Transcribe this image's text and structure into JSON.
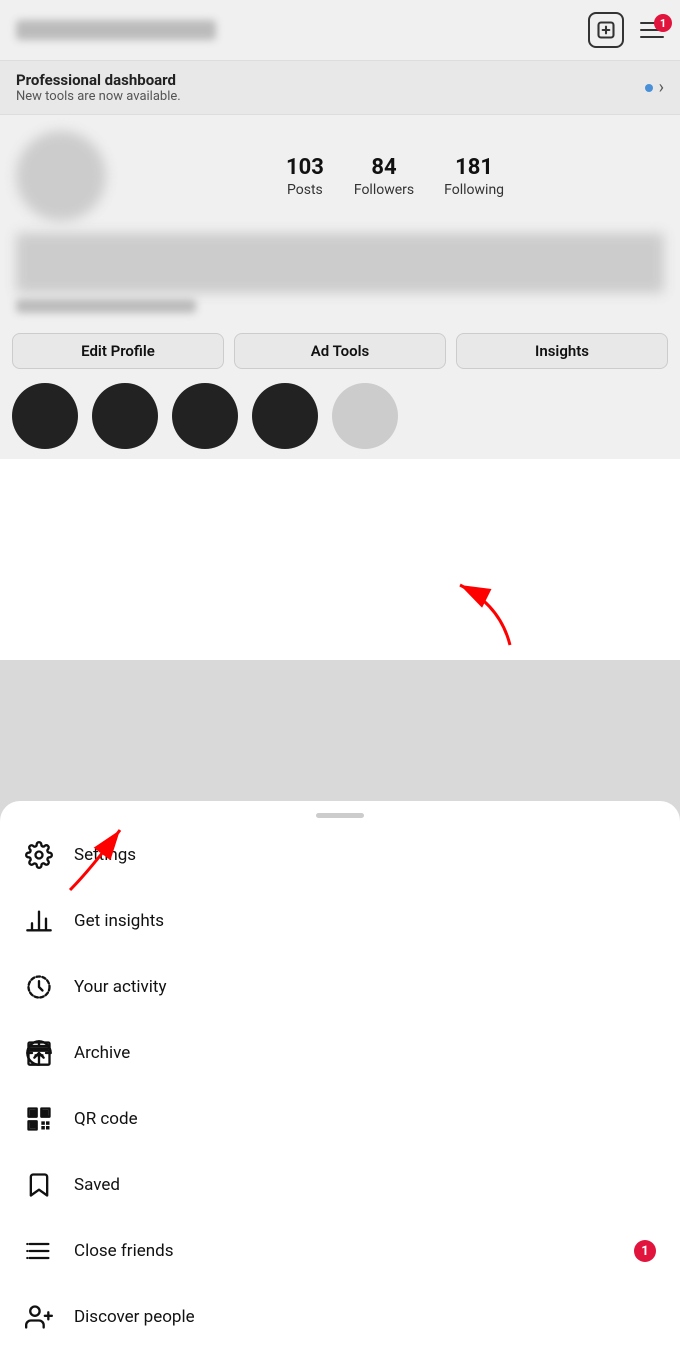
{
  "header": {
    "plus_icon_label": "+",
    "menu_badge": "1"
  },
  "pro_dashboard": {
    "title": "Professional dashboard",
    "subtitle": "New tools are now available."
  },
  "profile": {
    "posts_count": "103",
    "posts_label": "Posts",
    "followers_count": "84",
    "followers_label": "Followers",
    "following_count": "181",
    "following_label": "Following"
  },
  "action_buttons": {
    "edit_profile": "Edit Profile",
    "ad_tools": "Ad Tools",
    "insights": "Insights"
  },
  "menu": {
    "items": [
      {
        "id": "settings",
        "label": "Settings",
        "icon": "settings"
      },
      {
        "id": "get-insights",
        "label": "Get insights",
        "icon": "bar-chart"
      },
      {
        "id": "your-activity",
        "label": "Your activity",
        "icon": "activity"
      },
      {
        "id": "archive",
        "label": "Archive",
        "icon": "archive"
      },
      {
        "id": "qr-code",
        "label": "QR code",
        "icon": "qr"
      },
      {
        "id": "saved",
        "label": "Saved",
        "icon": "bookmark"
      },
      {
        "id": "close-friends",
        "label": "Close friends",
        "icon": "close-friends",
        "badge": "1"
      },
      {
        "id": "discover-people",
        "label": "Discover people",
        "icon": "person-add"
      }
    ]
  }
}
